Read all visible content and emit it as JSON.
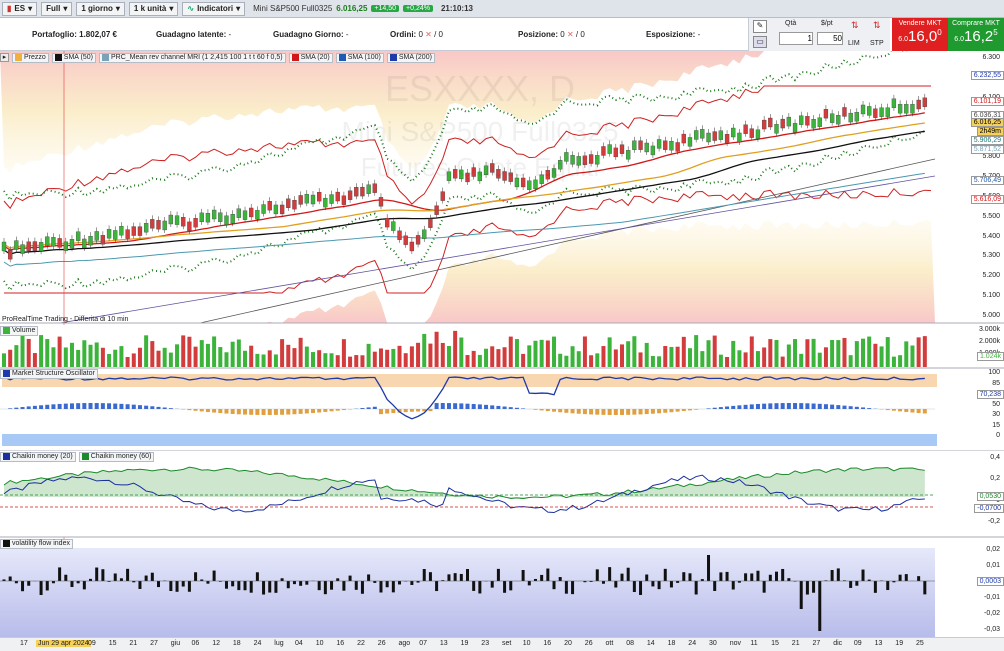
{
  "toolbar": {
    "symbol": "ES",
    "type": "Full",
    "timeframe": "1 giorno",
    "units": "1 k unità",
    "indicators": "Indicatori",
    "title": "Mini S&P500 Full0325",
    "price": "6.016,25",
    "change": "+14,50",
    "change_pct": "+0,24%",
    "time": "21:10:13"
  },
  "info": {
    "portfolio_label": "Portafoglio:",
    "portfolio_value": "1.802,07 €",
    "latent_label": "Guadagno latente:",
    "latent_value": "-",
    "day_label": "Guadagno Giorno:",
    "day_value": "-",
    "orders_label": "Ordini:",
    "orders_value": "0",
    "orders_total": "/ 0",
    "position_label": "Posizione:",
    "position_value": "0",
    "position_total": "/ 0",
    "exposure_label": "Esposizione:",
    "exposure_value": "-"
  },
  "order_panel": {
    "qty_label": "Qtà",
    "qty_value": "1",
    "pt_label": "$/pt",
    "pt_value": "50",
    "lim": "LIM",
    "stp": "STP"
  },
  "sell": {
    "label": "Vendere MKT",
    "prefix": "6.0",
    "big": "16,0",
    "suffix": "0"
  },
  "buy": {
    "label": "Comprare MKT",
    "prefix": "6.0",
    "big": "16,2",
    "suffix": "5"
  },
  "price_panel": {
    "legend": [
      "Prezzo",
      "SMA (50)",
      "PRC_Mean rev channel MRI (1 2,415 100 1 t t 60 f 0,5)",
      "SMA (20)",
      "SMA (100)",
      "SMA (200)"
    ],
    "legend_colors": [
      "#f0b040",
      "#111111",
      "#7aa2b8",
      "#d01818",
      "#1e5ab4",
      "#1e3aa8"
    ],
    "watermark_1": "ESXXXX, D",
    "watermark_2": "Mini S&P500 Full0325",
    "watermark_3": "Futures Quote Equiti",
    "footer": "ProRealTime Trading - Differita di 10 min",
    "axis": [
      "6.300",
      "6.200",
      "6.100",
      "6.000",
      "5.900",
      "5.800",
      "5.700",
      "5.600",
      "5.500",
      "5.400",
      "5.300",
      "5.200",
      "5.100",
      "5.000"
    ],
    "tags": [
      "6.232,55",
      "6.101,19",
      "6.036,31",
      "6.016,25",
      "2h49m",
      "5.906,29",
      "5.871,52",
      "5.706,49",
      "5.616,09"
    ]
  },
  "volume_panel": {
    "legend": "Volume",
    "axis": [
      "3.000k",
      "2.000k",
      "1.000k"
    ],
    "tag": "1.024k"
  },
  "mso_panel": {
    "legend": "Market Structure Oscillator",
    "axis": [
      "100",
      "85",
      "70",
      "50",
      "30",
      "15",
      "0"
    ],
    "tag": "70,238"
  },
  "chaikin_panel": {
    "legend": [
      "Chaikin money (20)",
      "Chaikin money (60)"
    ],
    "legend_colors": [
      "#1a2fa0",
      "#1a8a2a"
    ],
    "axis": [
      "0,4",
      "0,2",
      "0",
      "-0,2"
    ],
    "tags": [
      "0,0530",
      "-0,0700"
    ]
  },
  "vfi_panel": {
    "legend": "volatility flow index",
    "axis": [
      "0,02",
      "0,01",
      "0",
      "-0,01",
      "-0,02",
      "-0,03"
    ],
    "tag": "0,0003"
  },
  "xaxis": [
    "17",
    "Jun 29 apr 2024",
    "09",
    "15",
    "21",
    "27",
    "giu",
    "06",
    "12",
    "18",
    "24",
    "lug",
    "04",
    "10",
    "16",
    "22",
    "26",
    "ago",
    "07",
    "13",
    "19",
    "23",
    "set",
    "10",
    "16",
    "20",
    "26",
    "ott",
    "08",
    "14",
    "18",
    "24",
    "30",
    "nov",
    "11",
    "15",
    "21",
    "27",
    "dic",
    "09",
    "13",
    "19",
    "25"
  ],
  "colors": {
    "up": "#3cb43c",
    "down": "#d23c3c",
    "sell": "#e02020",
    "buy": "#1f9a2f"
  }
}
